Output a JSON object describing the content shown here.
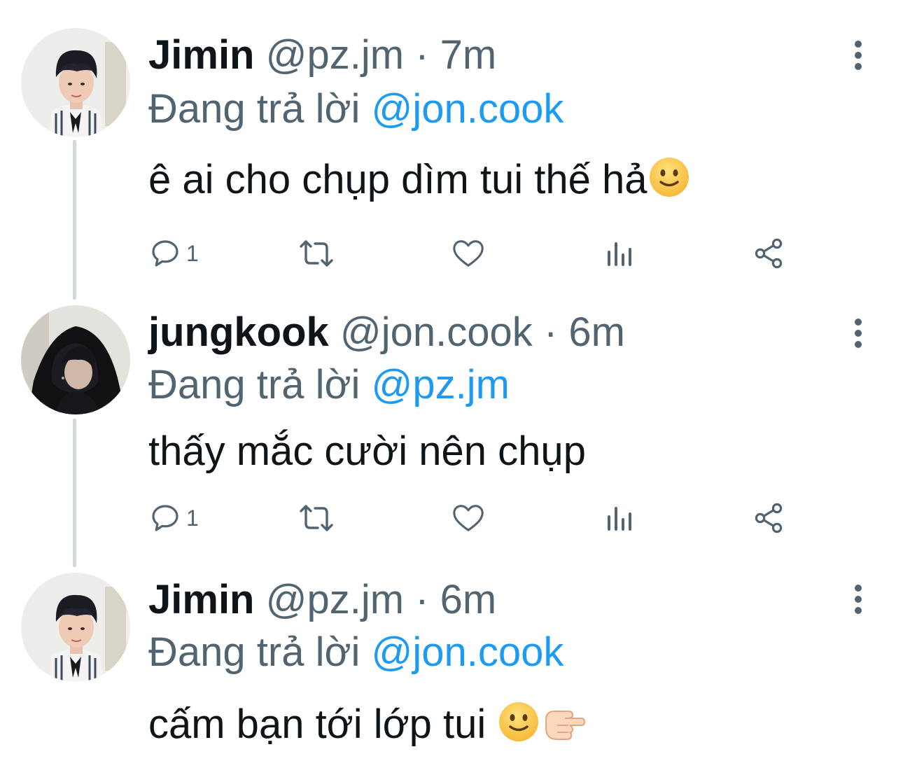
{
  "colors": {
    "text_primary": "#0f1419",
    "text_secondary": "#536471",
    "link": "#1d9bf0",
    "thread_line": "#cfd9de"
  },
  "tweets": [
    {
      "name": "Jimin",
      "handle": "@pz.jm",
      "separator": "·",
      "time": "7m",
      "reply_prefix": "Đang trả lời",
      "reply_to": "@jon.cook",
      "text": "ê ai cho chụp dìm tui thế hả",
      "emojis": [
        "slightly-smiling-face"
      ],
      "reply_count": "1",
      "avatar": "jimin-avatar"
    },
    {
      "name": "jungkook",
      "handle": "@jon.cook",
      "separator": "·",
      "time": "6m",
      "reply_prefix": "Đang trả lời",
      "reply_to": "@pz.jm",
      "text": "thấy mắc cười nên chụp",
      "emojis": [],
      "reply_count": "1",
      "avatar": "jungkook-avatar"
    },
    {
      "name": "Jimin",
      "handle": "@pz.jm",
      "separator": "·",
      "time": "6m",
      "reply_prefix": "Đang trả lời",
      "reply_to": "@jon.cook",
      "text": "cấm bạn tới lớp tui",
      "emojis": [
        "slightly-smiling-face",
        "backhand-index-pointing-right"
      ],
      "reply_count": "",
      "avatar": "jimin-avatar"
    }
  ],
  "action_icons": [
    "reply-icon",
    "retweet-icon",
    "like-icon",
    "views-icon",
    "share-icon"
  ]
}
